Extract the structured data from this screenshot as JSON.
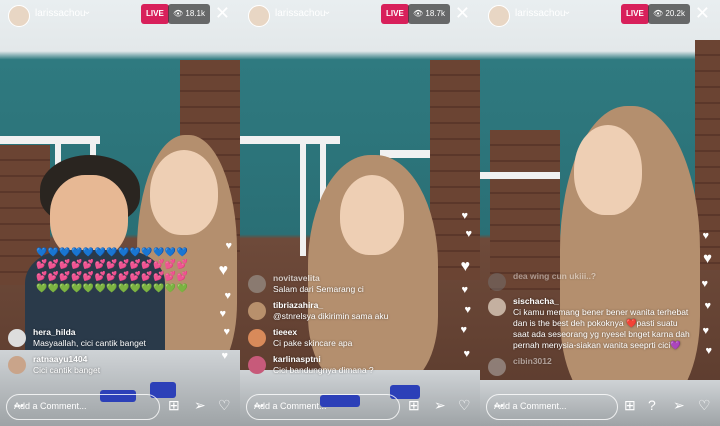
{
  "username": "larissachou",
  "live_label": "LIVE",
  "comment_placeholder": "Add a Comment...",
  "panels": [
    {
      "viewers": "18.1k",
      "comments": [
        {
          "user": "hera_hilda",
          "text": "Masyaallah, cici cantik banget"
        },
        {
          "user": "ratnaayu1404",
          "text": "Cici cantik banget"
        }
      ],
      "heart_rows": [
        {
          "color": "blue",
          "glyphs": "💙💙💙💙💙💙💙💙💙💙💙💙💙"
        },
        {
          "color": "pink",
          "glyphs": "💕💕💕💕💕💕💕💕💕💕💕💕💕"
        },
        {
          "color": "pink",
          "glyphs": "💕💕💕💕💕💕💕💕💕💕💕💕💕"
        },
        {
          "color": "green",
          "glyphs": "💚💚💚💚💚💚💚💚💚💚💚💚💚"
        }
      ]
    },
    {
      "viewers": "18.7k",
      "comments": [
        {
          "user": "novitavelita",
          "text": "Salam dari Semarang ci"
        },
        {
          "user": "tibriazahira_",
          "text": "@stnrelsya dikirimin sama aku"
        },
        {
          "user": "tieeex",
          "text": "Ci pake skincare apa"
        },
        {
          "user": "karlinasptni",
          "text": "Cici bandungnya dimana ?"
        }
      ]
    },
    {
      "viewers": "20.2k",
      "comments": [
        {
          "user": "dea wing cun ukiii..?",
          "text": ""
        },
        {
          "user": "sischacha_",
          "text": "Ci kamu memang bener bener wanita terhebat dan is the best deh pokoknya ❤️pasti suatu saat ada seseorang yg nyesel bnget karna dah pernah menysia-siakan wanita seeprti cici💜"
        },
        {
          "user": "cibin3012",
          "text": ""
        }
      ]
    }
  ],
  "icons": {
    "more": "more-dots-icon",
    "add_video": "add-video-icon",
    "question": "question-icon",
    "send": "send-icon",
    "heart": "heart-icon",
    "close": "close-icon",
    "chevron": "chevron-down-icon",
    "eye": "eye-icon"
  },
  "colors": {
    "live": "#d8205b",
    "heart_blue": "#3b82f6",
    "heart_pink": "#ee4b9c",
    "heart_green": "#7bc84a"
  }
}
